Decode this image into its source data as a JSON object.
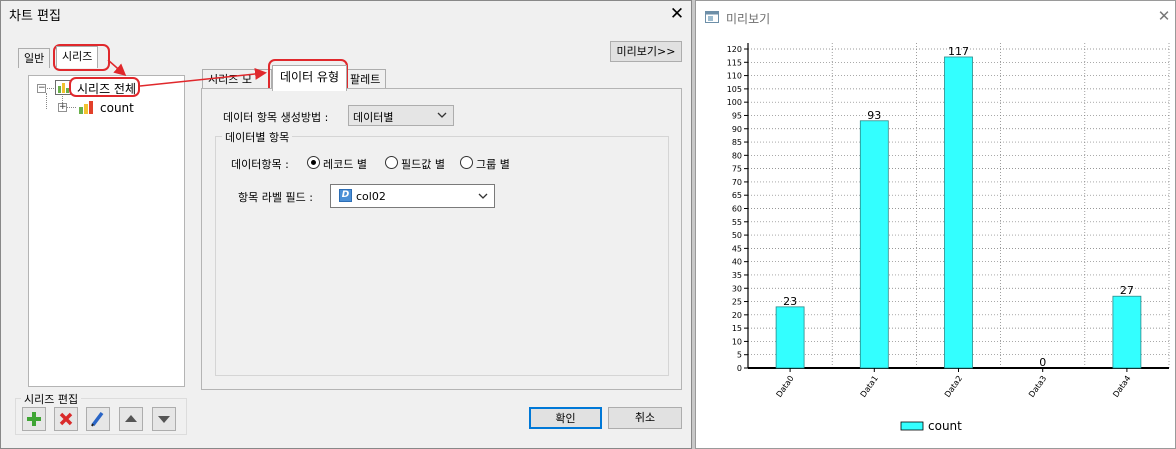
{
  "dialog": {
    "title": "차트 편집",
    "top_tabs": [
      "일반",
      "시리즈"
    ],
    "preview_button": "미리보기>>",
    "tree": {
      "root": "시리즈 전체",
      "child": "count"
    },
    "inner_tabs": [
      "시리즈 모",
      "데이터 유형",
      "팔레트"
    ],
    "data_gen_label": "데이터 항목 생성방법 :",
    "data_gen_value": "데이터별",
    "group_title": "데이터별 항목",
    "data_item_label": "데이터항목 :",
    "radios": [
      "레코드 별",
      "필드값 별",
      "그룹 별"
    ],
    "radio_selected": 0,
    "label_field_label": "항목 라벨 필드 :",
    "label_field_value": "col02",
    "field_type_icon": "D",
    "series_edit_title": "시리즈 편집",
    "tool_icons": [
      "add-icon",
      "delete-icon",
      "edit-icon",
      "move-up-icon",
      "move-down-icon"
    ],
    "ok": "확인",
    "cancel": "취소"
  },
  "colors": {
    "highlight": "#e0282c",
    "bar": "#33ffff",
    "bar_stroke": "#2a8a8a"
  },
  "preview": {
    "title": "미리보기"
  },
  "chart_data": {
    "type": "bar",
    "categories": [
      "Data0",
      "Data1",
      "Data2",
      "Data3",
      "Data4"
    ],
    "series": [
      {
        "name": "count",
        "values": [
          23,
          93,
          117,
          0,
          27
        ]
      }
    ],
    "ylim": [
      0,
      120
    ],
    "ytick_step": 5,
    "data_labels": true,
    "grid": true,
    "legend": "bottom"
  }
}
